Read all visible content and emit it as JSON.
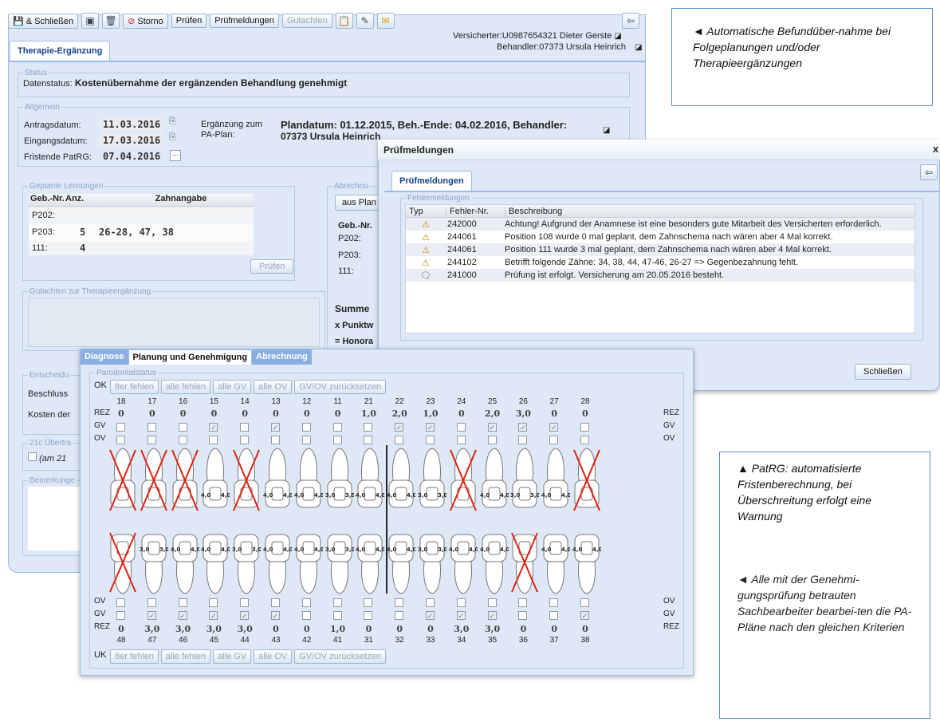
{
  "toolbar": {
    "close_save": "& Schließen",
    "cancel": "Storno",
    "check": "Prüfen",
    "messages": "Prüfmeldungen",
    "reports": "Gutachten"
  },
  "header": {
    "insurant_label": "Versicherter:",
    "insurant_value": "U0987654321 Dieter Gerste",
    "practitioner_label": "Behandler:",
    "practitioner_value": "07373 Ursula Heinrich"
  },
  "main_tab": "Therapie-Ergänzung",
  "status": {
    "legend": "Status",
    "label": "Datenstatus:",
    "value": "Kostenübernahme der ergänzenden Behandlung genehmigt"
  },
  "general": {
    "legend": "Allgemein",
    "application_label": "Antragsdatum:",
    "application_value": "11.03.2016",
    "receipt_label": "Eingangsdatum:",
    "receipt_value": "17.03.2016",
    "deadline_label": "Fristende PatRG:",
    "deadline_value": "07.04.2016",
    "supplement_label_1": "Ergänzung zum",
    "supplement_label_2": "PA-Plan:",
    "plan_line_1": "Plandatum: 01.12.2015, Beh.-Ende: 04.02.2016, Behandler:",
    "plan_line_2": "07373 Ursula Heinrich"
  },
  "planned": {
    "legend": "Geplante Leistungen",
    "headers": [
      "Geb.-Nr.",
      "Anz.",
      "Zahnangabe"
    ],
    "rows": [
      {
        "code": "P202:",
        "count": "",
        "teeth": ""
      },
      {
        "code": "P203:",
        "count": "5",
        "teeth": "26-28, 47, 38"
      },
      {
        "code": "111:",
        "count": "4",
        "teeth": ""
      }
    ],
    "check_button": "Prüfen"
  },
  "billing": {
    "legend": "Abrechnu",
    "from_plan": "aus Plan",
    "header": "Geb.-Nr.",
    "rows": [
      "P202:",
      "P203:",
      "111:"
    ],
    "sum": "Summe",
    "points": "x Punktw",
    "fee": "= Honora"
  },
  "expertise": {
    "legend": "Gutachten zur Therapieergänzung"
  },
  "decision": {
    "legend": "Entscheidu",
    "resolution": "Beschluss",
    "costs": "Kosten der"
  },
  "transfer": {
    "legend": "21c Übertra",
    "checkbox_label": "(am 21"
  },
  "remarks": {
    "legend": "Bemerkunge"
  },
  "dialog": {
    "title": "Prüfmeldungen",
    "tab": "Prüfmeldungen",
    "legend": "Fehlermeldungen",
    "headers": [
      "Typ",
      "Fehler-Nr.",
      "Beschreibung"
    ],
    "rows": [
      {
        "type": "warning-icon",
        "nr": "242000",
        "text": "Achtung! Aufgrund der Anamnese ist eine besonders gute Mitarbeit des Versicherten erforderlich."
      },
      {
        "type": "warning-icon",
        "nr": "244061",
        "text": "Position 108 wurde 0 mal geplant, dem Zahnschema nach wären aber 4 Mal korrekt."
      },
      {
        "type": "warning-icon",
        "nr": "244061",
        "text": "Position 111 wurde 3 mal geplant, dem Zahnschema nach wären aber 4 Mal korrekt."
      },
      {
        "type": "warning-icon",
        "nr": "244102",
        "text": "Betrifft folgende Zähne: 34, 38, 44, 47-46, 26-27 => Gegenbezahnung fehlt."
      },
      {
        "type": "info-icon",
        "nr": "241000",
        "text": "Prüfung ist erfolgt. Versicherung am 20.05.2016 besteht."
      }
    ],
    "close_button": "Schließen",
    "close_x": "x"
  },
  "scheme": {
    "tabs": [
      "Diagnose",
      "Planung und Genehmigung",
      "Abrechnung"
    ],
    "legend": "Parodontalstatus",
    "ok_label": "OK",
    "uk_label": "UK",
    "buttons": [
      "8er fehlen",
      "alle fehlen",
      "alle GV",
      "alle OV",
      "GV/OV zurücksetzen"
    ],
    "upper_numbers": [
      "18",
      "17",
      "16",
      "15",
      "14",
      "13",
      "12",
      "11",
      "21",
      "22",
      "23",
      "24",
      "25",
      "26",
      "27",
      "28"
    ],
    "upper_rez": [
      "0",
      "0",
      "0",
      "0",
      "0",
      "0",
      "0",
      "0",
      "1,0",
      "2,0",
      "1,0",
      "0",
      "2,0",
      "3,0",
      "0",
      "0"
    ],
    "upper_gv": [
      false,
      false,
      false,
      true,
      false,
      true,
      false,
      false,
      false,
      true,
      true,
      false,
      true,
      true,
      true,
      false
    ],
    "upper_missing": [
      true,
      true,
      true,
      false,
      true,
      false,
      false,
      false,
      false,
      false,
      false,
      true,
      false,
      false,
      false,
      true
    ],
    "lower_numbers": [
      "48",
      "47",
      "46",
      "45",
      "44",
      "43",
      "42",
      "41",
      "31",
      "32",
      "33",
      "34",
      "35",
      "36",
      "37",
      "38"
    ],
    "lower_rez": [
      "0",
      "3,0",
      "3,0",
      "3,0",
      "3,0",
      "0",
      "0",
      "1,0",
      "0",
      "0",
      "0",
      "3,0",
      "3,0",
      "0",
      "0",
      "0"
    ],
    "lower_gv": [
      false,
      true,
      true,
      true,
      true,
      true,
      false,
      false,
      false,
      false,
      true,
      true,
      true,
      false,
      false,
      true
    ],
    "lower_missing": [
      true,
      false,
      false,
      false,
      false,
      false,
      false,
      false,
      false,
      false,
      false,
      false,
      false,
      true,
      false,
      false
    ],
    "row_labels": {
      "rez": "REZ",
      "gv": "GV",
      "ov": "OV"
    },
    "pocket_value": "4,0",
    "pocket_value_b": "3,0"
  },
  "notes": [
    "◄ Automatische Befundüber-nahme bei Folgeplanungen und/oder Therapieergänzungen",
    "▲ PatRG: automatisierte Fristenberechnung, bei Überschreitung erfolgt eine Warnung",
    "◄ Alle mit der Genehmi-gungsprüfung betrauten Sachbearbeiter bearbei-ten die PA-Pläne nach den gleichen Kriterien"
  ]
}
